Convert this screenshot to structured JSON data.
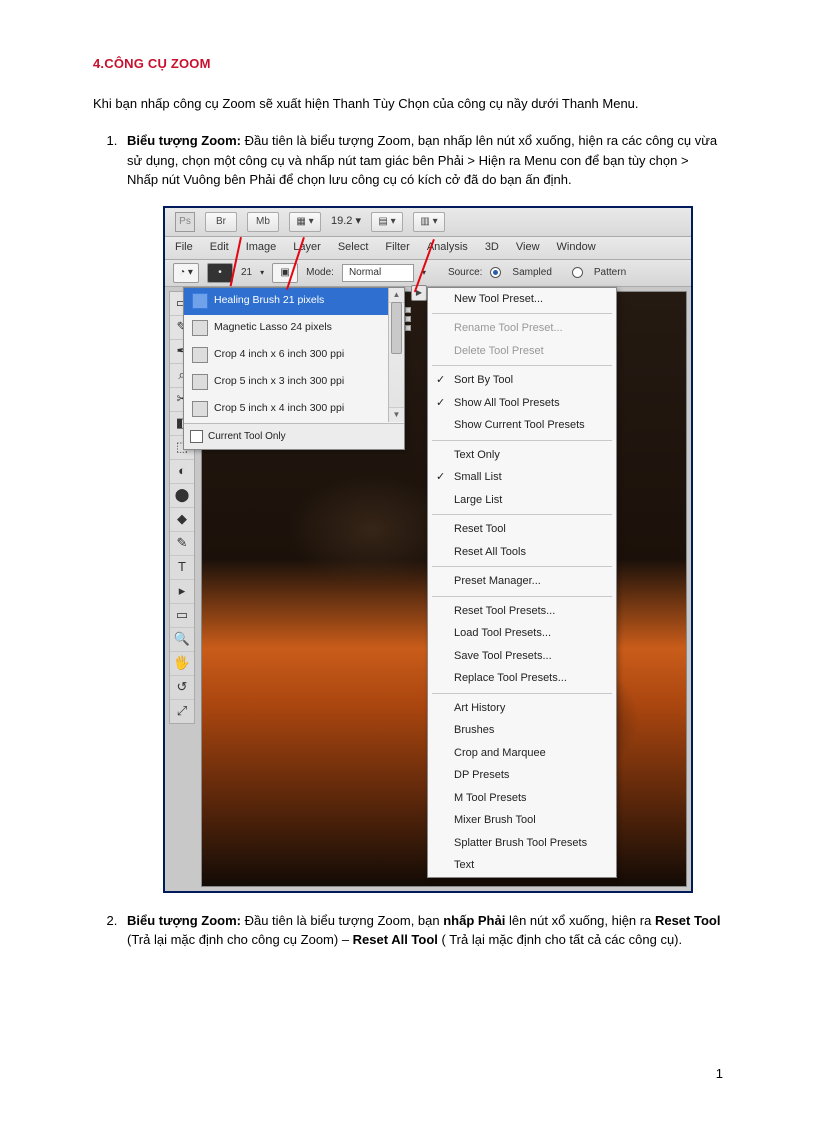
{
  "section_title": "4.CÔNG CỤ ZOOM",
  "intro": "Khi bạn nhấp công cụ Zoom sẽ xuất hiện Thanh Tùy Chọn của công cụ nầy dưới Thanh Menu.",
  "items": [
    {
      "b1": "Biểu tượng Zoom:",
      "body": " Đầu tiên là biểu tượng Zoom, bạn nhấp lên nút xổ xuống, hiện ra các công cụ vừa sử dụng, chọn một công cụ và nhấp nút tam giác bên Phải > Hiện ra Menu con để bạn tùy chọn  > Nhấp nút Vuông bên Phải để chọn lưu công cụ có kích cở đã do bạn ấn định."
    },
    {
      "b1": "Biểu tượng Zoom:",
      "pre": " Đầu tiên là biểu tượng Zoom, bạn ",
      "b2": "nhấp Phải",
      "mid": " lên nút xổ xuống, hiện ra ",
      "b3": "Reset Tool",
      "mid2": " (Trả lại mặc định cho công cụ Zoom) – ",
      "b4": "Reset All Tool",
      "end": " ( Trả lại mặc định cho tất cả các công cụ)."
    }
  ],
  "ps": {
    "titlebar": {
      "logo": "Ps",
      "btn_br": "Br",
      "btn_mb": "Mb",
      "zoom": "19.2 ▾"
    },
    "menus": [
      "File",
      "Edit",
      "Image",
      "Layer",
      "Select",
      "Filter",
      "Analysis",
      "3D",
      "View",
      "Window"
    ],
    "optbar": {
      "size": "21",
      "mode_label": "Mode:",
      "mode_value": "Normal",
      "source_label": "Source:",
      "sampled": "Sampled",
      "pattern": "Pattern"
    },
    "presets": [
      "Healing Brush 21 pixels",
      "Magnetic Lasso 24 pixels",
      "Crop 4 inch x 6 inch 300 ppi",
      "Crop 5 inch x 3 inch 300 ppi",
      "Crop 5 inch x 4 inch 300 ppi"
    ],
    "preset_footer": "Current Tool Only",
    "context_menu": {
      "g1": [
        "New Tool Preset..."
      ],
      "g2": [
        "Rename Tool Preset...",
        "Delete Tool Preset"
      ],
      "g3": [
        {
          "chk": true,
          "label": "Sort By Tool"
        },
        {
          "chk": true,
          "label": "Show All Tool Presets"
        },
        {
          "chk": false,
          "label": "Show Current Tool Presets"
        }
      ],
      "g4": [
        {
          "chk": false,
          "label": "Text Only"
        },
        {
          "chk": true,
          "label": "Small List"
        },
        {
          "chk": false,
          "label": "Large List"
        }
      ],
      "g5": [
        "Reset Tool",
        "Reset All Tools"
      ],
      "g6": [
        "Preset Manager..."
      ],
      "g7": [
        "Reset Tool Presets...",
        "Load Tool Presets...",
        "Save Tool Presets...",
        "Replace Tool Presets..."
      ],
      "g8": [
        "Art History",
        "Brushes",
        "Crop and Marquee",
        "DP Presets",
        "M Tool Presets",
        "Mixer Brush Tool",
        "Splatter Brush Tool Presets",
        "Text"
      ]
    },
    "tools": [
      "▭",
      "✎",
      "✒",
      "⌕",
      "✂",
      "◧",
      "⬚",
      "◐",
      "⬤",
      "◆",
      "✎",
      "T",
      "▸",
      "▭",
      "🔍",
      "🖐",
      "↺",
      "⤢"
    ]
  },
  "page_number": "1"
}
